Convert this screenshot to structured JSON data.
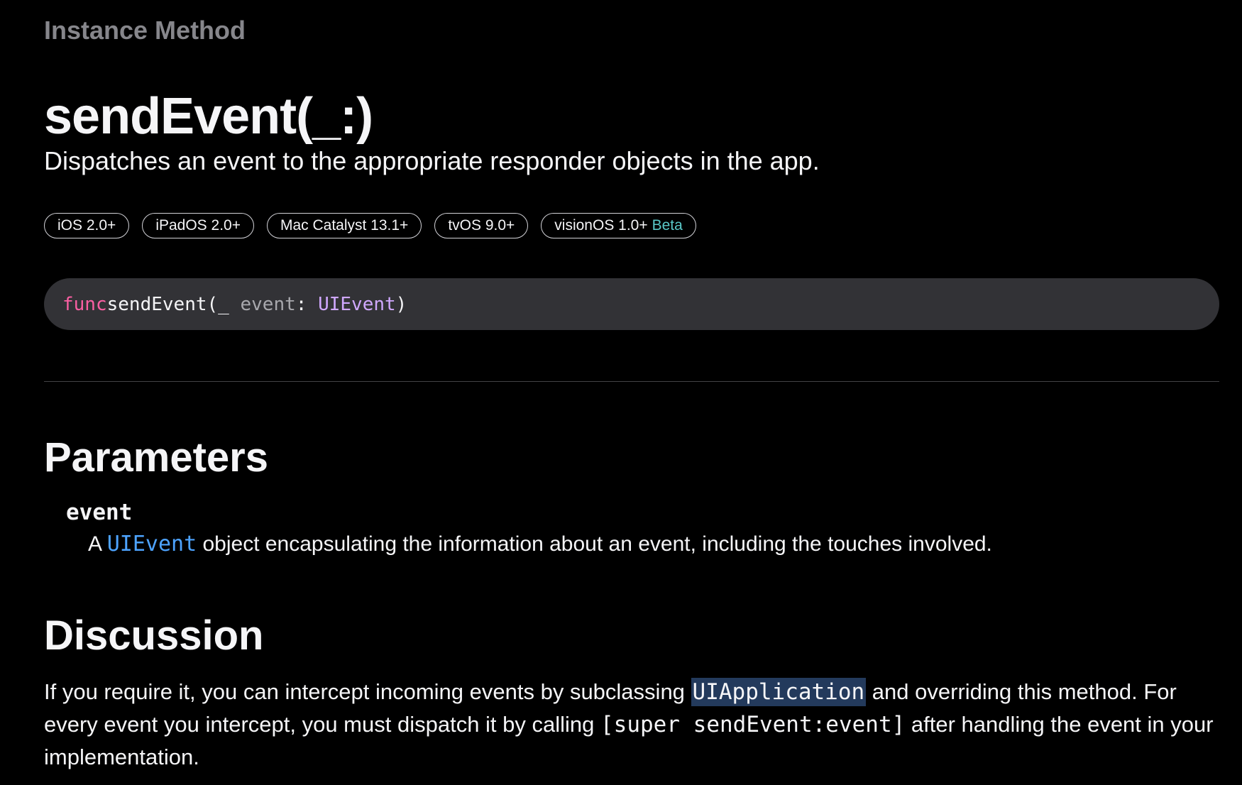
{
  "header": {
    "eyebrow": "Instance Method",
    "title": "sendEvent(_:)",
    "abstract": "Dispatches an event to the appropriate responder objects in the app."
  },
  "availability": [
    {
      "label": "iOS 2.0+"
    },
    {
      "label": "iPadOS 2.0+"
    },
    {
      "label": "Mac Catalyst 13.1+"
    },
    {
      "label": "tvOS 9.0+"
    },
    {
      "label": "visionOS 1.0+",
      "beta": "Beta"
    }
  ],
  "declaration": {
    "keyword": "func",
    "name": "sendEvent",
    "open": "(_ ",
    "param": "event",
    "colon": ": ",
    "type": "UIEvent",
    "close": ")"
  },
  "parameters": {
    "heading": "Parameters",
    "items": [
      {
        "name": "event",
        "desc_prefix": "A ",
        "desc_link": "UIEvent",
        "desc_suffix": " object encapsulating the information about an event, including the touches involved."
      }
    ]
  },
  "discussion": {
    "heading": "Discussion",
    "part1": "If you require it, you can intercept incoming events by subclassing ",
    "code1": "UIApplication",
    "part2": " and overriding this method. For every event you intercept, you must dispatch it by calling ",
    "code2": "[super sendEvent:event]",
    "part3": " after handling the event in your implementation."
  },
  "colors": {
    "background": "#000000",
    "keyword": "#fc5fa3",
    "type": "#d0a8ff",
    "link": "#4da3ff",
    "beta": "#5ac8c8",
    "selection": "#233a5c"
  }
}
